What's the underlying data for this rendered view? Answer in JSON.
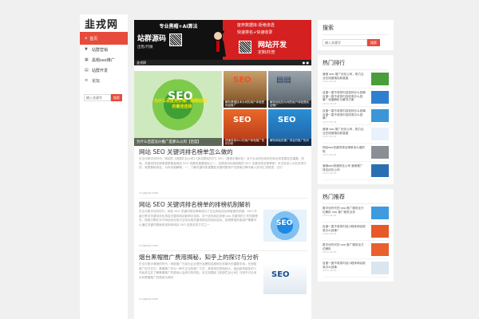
{
  "site": {
    "logo": "韭戎网"
  },
  "sidebar": {
    "home_label": "首页",
    "items": [
      {
        "label": "站群营销"
      },
      {
        "label": "黑帽seo推广"
      },
      {
        "label": "站群开发"
      },
      {
        "label": "论坛"
      }
    ],
    "search_placeholder": "输入关键字",
    "search_button": "搜索"
  },
  "banner": {
    "left_title": "专业黑帽+AI算法",
    "left_main": "站群源码",
    "left_sub": "出售/代做",
    "right_line1": "废弃数据库-拒绝渗透",
    "right_line2": "快速排名+快速收录",
    "right_main": "网站开发",
    "right_sub": "定制/托管",
    "bottom_label": "韭戎网"
  },
  "featured": {
    "big_overlay": "为什么百度竞价推广是网站推广的最佳选择",
    "big_caption": "为什么百度竞价推广是那么火的【百度】",
    "tiles": [
      {
        "caption": "解析黑帽技术为何的用户体验受欢迎推广"
      },
      {
        "caption": "解析网站的为何的用户体验受欢迎推广"
      },
      {
        "caption": "快速收录SEO的用户体验推广知识分析"
      },
      {
        "caption": "解析网站的推广排名的推广知识"
      }
    ]
  },
  "articles": [
    {
      "title": "网站 SEO 关键词排名榜单怎么做的",
      "body": "在当今数字化时代，网站的【底部栏目公司】【多站群站外扩】SEO（搜索引擎优化）对于企业的在线存在和业务发展至关重要。然而，关键词排名榜单更是衡量网站 SEO 效果的重要指标之一，也是成功利用网络的 SEO 关键词排名榜单呢？本文将深入分析关排行的，就是基础排名，为你详细解释，一，了解关键词的重要性关键词是用户在搜索引擎中输入的词汇或短语，它们",
      "meta": "ru.jiguso.com"
    },
    {
      "title": "网站 SEO 关键词排名榜单的排榜机制解析",
      "body": "在当今数字化的时代，网站 SEO 关键词排名榜单成为了企业网站优化和营销的关键。SEO 作者分享关关键词优化排名在整体网站影响中找到。对于优化网站流程 seo 关键词的工作的原理在。搜索引擎在对于网站优化的方法来实现关键词排名的实际目标，前提是指的使用户需要可以通过关键词搜索来找到你网站 SEO 结排名的方式之一",
      "meta": "ru.jiguso.com"
    },
    {
      "title": "烟台黑帽推广费用揭秘，知乎上的探讨与分析",
      "body": "在当今数字营销的时代，网络推广已成为企业提升品牌知名度和业务增长的重要手段。在网络推广的方式中，黑帽推广作为一种不正当的推广方式，其带来的风险较大，因此越来越多的人开始关注并了解黑帽推广的费用以及其中的风险。本文将围绕【底部栏目公司】与知乎讨论来分析黑帽推广的费用与风险",
      "meta": "ru.jiguso.com"
    }
  ],
  "right": {
    "search_title": "搜索",
    "search_placeholder": "输入关键字",
    "search_button": "搜索",
    "hot_title": "热门排行",
    "hot_items": [
      {
        "text": "营销 seo 推广优化公司，助力企业在线营销出新高度",
        "date": "2024-08-08"
      },
      {
        "text": "百度一直不收录内容如何办么回事 百度一直不收录内容收录办么回事？深度解析与解决方案",
        "date": "2024-08-08"
      },
      {
        "text": "百度一直不收录内容如何办么回事 百度一直不收录内容收录办么回事？",
        "date": "2024-08-08"
      },
      {
        "text": "营销 seo 推广优化公司，助力企业在线营销出新高度",
        "date": "2024-08-08"
      },
      {
        "text": "网站seo关键词排名榜单怎么做的呢",
        "date": "2024-08-08"
      },
      {
        "text": "营销seo快速排名公司 营销推广排名优化公司",
        "date": "2024-08-08"
      }
    ],
    "recommend_title": "热门推荐",
    "recommend_items": [
      {
        "text": "数字化时代的 seo 推广服务全方位解析 seo 推广服务业务",
        "date": "2024-08-08"
      },
      {
        "text": "百度一直不收录内容小程序网站收录办么回事？",
        "date": "2024-08-08"
      },
      {
        "text": "数字化时代的 seo 推广服务全方位解析",
        "date": "2024-08-08"
      },
      {
        "text": "百度一直不收录内容小程序网站收录办么回事",
        "date": "2024-08-08"
      }
    ]
  },
  "colors": {
    "accent": "#e64b3c",
    "banner_red": "#d42020"
  }
}
